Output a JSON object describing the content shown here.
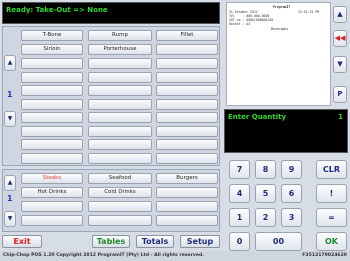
{
  "status": {
    "text": "Ready: Take-Out  => None"
  },
  "products": {
    "row1": [
      "T-Bone",
      "Rump",
      "Fillet"
    ],
    "row2": [
      "Sirloin",
      "Porterhouse",
      ""
    ],
    "page": "1"
  },
  "categories": {
    "row1": [
      "Steaks",
      "Seafood",
      "Burgers"
    ],
    "row2": [
      "Hot Drinks",
      "Cold Drinks",
      ""
    ],
    "active": "Steaks",
    "page": "1"
  },
  "receipt": {
    "company": "ProgramIT",
    "date": "31 October 2012",
    "time": "12:52:15 PM",
    "tel": "Tel    : 000-000-0000",
    "vat": "VAT no : 0000/000000/00",
    "docket": "Docket : A3",
    "section": "Beverages"
  },
  "side_buttons": {
    "print": "P"
  },
  "quantity": {
    "label": "Enter Quantity",
    "value": "1"
  },
  "keypad": {
    "keys": [
      "7",
      "8",
      "9",
      "4",
      "5",
      "6",
      "1",
      "2",
      "3",
      "0",
      "00"
    ],
    "clr": "CLR",
    "bang": "!",
    "equals": "=",
    "ok": "OK"
  },
  "buttons": {
    "exit": "Exit",
    "tables": "Tables",
    "totals": "Totals",
    "setup": "Setup"
  },
  "footer": {
    "copyright": "Chip-Chop POS 1.20 Copyright 2012 ProgramIT (Pty) Ltd - All rights reserved.",
    "code": "F3513179024620"
  },
  "colors": {
    "status_green": "#2fd82f",
    "exit_red": "#e0201c",
    "tables_green": "#1e8a2a",
    "nav_blue": "#1c2e7a"
  }
}
